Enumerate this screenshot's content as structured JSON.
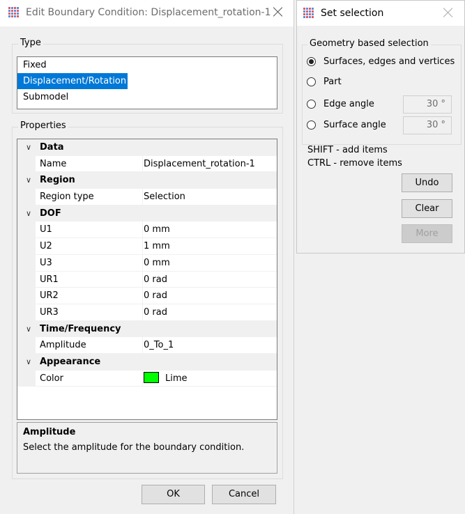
{
  "boundary_dialog": {
    "title": "Edit Boundary Condition: Displacement_rotation-1",
    "type_group": {
      "label": "Type",
      "items": [
        "Fixed",
        "Displacement/Rotation",
        "Submodel"
      ],
      "selected": "Displacement/Rotation"
    },
    "properties_group": {
      "label": "Properties",
      "categories": [
        {
          "name": "Data",
          "rows": [
            {
              "name": "Name",
              "value": "Displacement_rotation-1"
            }
          ]
        },
        {
          "name": "Region",
          "rows": [
            {
              "name": "Region type",
              "value": "Selection"
            }
          ]
        },
        {
          "name": "DOF",
          "rows": [
            {
              "name": "U1",
              "value": "0 mm"
            },
            {
              "name": "U2",
              "value": "1 mm"
            },
            {
              "name": "U3",
              "value": "0 mm"
            },
            {
              "name": "UR1",
              "value": "0 rad"
            },
            {
              "name": "UR2",
              "value": "0 rad"
            },
            {
              "name": "UR3",
              "value": "0 rad"
            }
          ]
        },
        {
          "name": "Time/Frequency",
          "rows": [
            {
              "name": "Amplitude",
              "value": "0_To_1"
            }
          ]
        },
        {
          "name": "Appearance",
          "rows": [
            {
              "name": "Color",
              "value": "Lime",
              "swatch": "#00ff00"
            }
          ]
        }
      ]
    },
    "help": {
      "title": "Amplitude",
      "description": "Select the amplitude for the boundary condition."
    },
    "ok_label": "OK",
    "cancel_label": "Cancel"
  },
  "selection_panel": {
    "title": "Set selection",
    "group_label": "Geometry based selection",
    "options": [
      {
        "label": "Surfaces, edges and vertices",
        "checked": true
      },
      {
        "label": "Part",
        "checked": false
      },
      {
        "label": "Edge angle",
        "checked": false,
        "angle": "30 °"
      },
      {
        "label": "Surface angle",
        "checked": false,
        "angle": "30 °"
      }
    ],
    "hint_shift": "SHIFT - add items",
    "hint_ctrl": "CTRL - remove items",
    "undo_label": "Undo",
    "clear_label": "Clear",
    "more_label": "More"
  },
  "colors": {
    "accent": "#0078d7",
    "lime": "#00ff00"
  },
  "icons": {
    "app": "app-grid-icon",
    "close": "close-icon",
    "expand": "chevron-down-icon"
  }
}
